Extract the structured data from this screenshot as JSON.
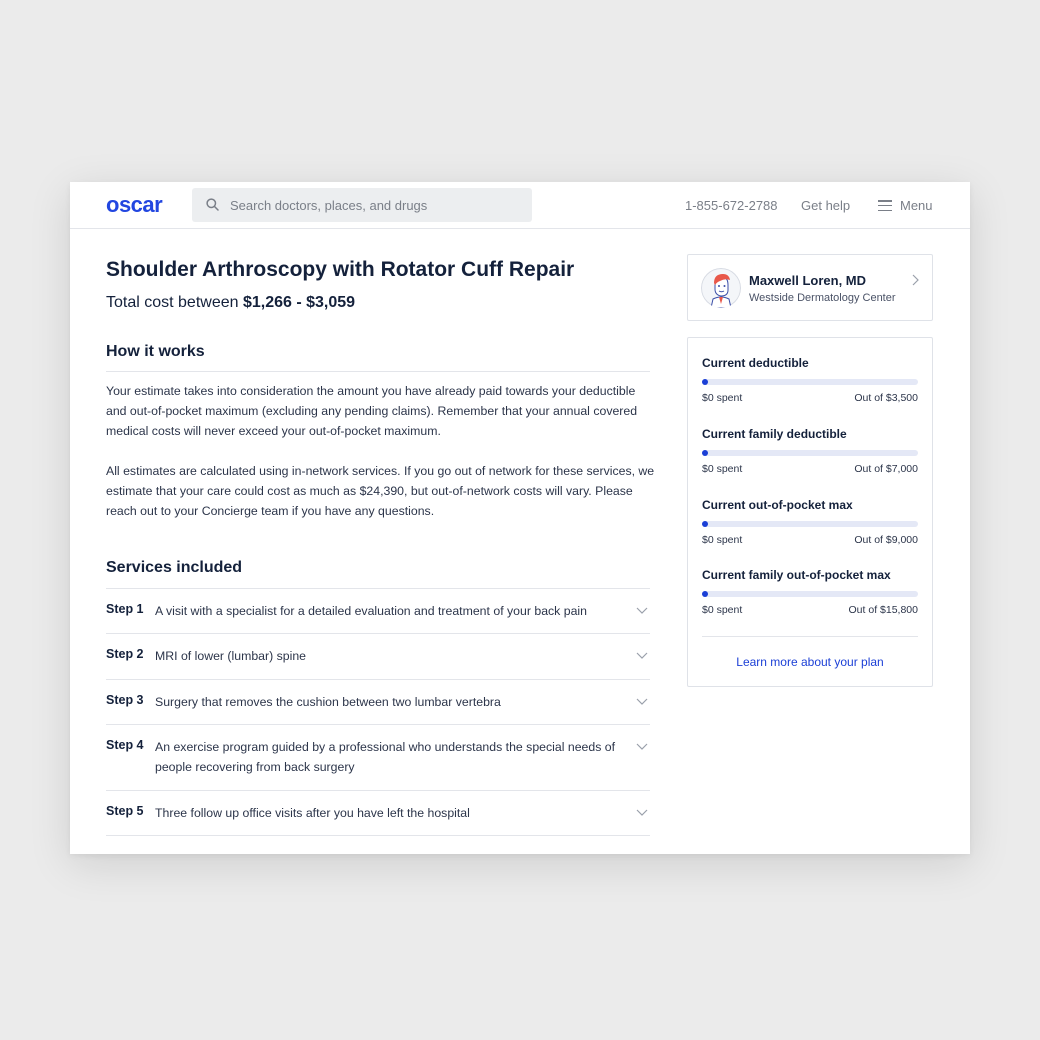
{
  "header": {
    "logo": "oscar",
    "search_placeholder": "Search doctors, places, and drugs",
    "phone": "1-855-672-2788",
    "help": "Get help",
    "menu": "Menu"
  },
  "procedure": {
    "title": "Shoulder Arthroscopy with Rotator Cuff Repair",
    "cost_prefix": "Total cost between ",
    "cost_range": "$1,266 - $3,059"
  },
  "how_it_works": {
    "heading": "How it works",
    "paragraph1": "Your estimate takes into consideration the amount you have already paid towards your deductible and out-of-pocket maximum (excluding any pending claims).  Remember that your annual covered medical costs will never exceed your out-of-pocket maximum.",
    "paragraph2": "All estimates are calculated using in-network services. If you go out of network for these services, we estimate that your care could cost as much as $24,390, but out-of-network costs will vary. Please reach out to your Concierge team if you have any questions."
  },
  "services": {
    "heading": "Services included",
    "steps": [
      {
        "label": "Step 1",
        "text": "A visit with a specialist for a detailed evaluation and treatment of your back pain"
      },
      {
        "label": "Step 2",
        "text": "MRI of lower (lumbar) spine"
      },
      {
        "label": "Step 3",
        "text": "Surgery that removes the cushion between two lumbar vertebra"
      },
      {
        "label": "Step 4",
        "text": "An exercise program guided by a professional who understands the special needs of people recovering from back surgery"
      },
      {
        "label": "Step 5",
        "text": "Three follow up office visits after you have left the hospital"
      }
    ]
  },
  "doctor": {
    "name": "Maxwell Loren, MD",
    "place": "Westside Dermatology Center"
  },
  "plan": {
    "items": [
      {
        "label": "Current deductible",
        "spent": "$0 spent",
        "total": "Out of $3,500",
        "progress": 0
      },
      {
        "label": "Current family deductible",
        "spent": "$0 spent",
        "total": "Out of $7,000",
        "progress": 0
      },
      {
        "label": "Current out-of-pocket max",
        "spent": "$0 spent",
        "total": "Out of $9,000",
        "progress": 0
      },
      {
        "label": "Current family out-of-pocket max",
        "spent": "$0 spent",
        "total": "Out of $15,800",
        "progress": 0
      }
    ],
    "link": "Learn more about your plan"
  },
  "colors": {
    "brand": "#2246e0",
    "progress": "#1b3fd6",
    "track": "#e4e8f6",
    "text": "#14213b"
  }
}
